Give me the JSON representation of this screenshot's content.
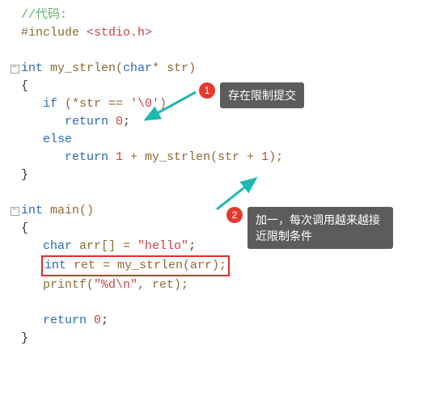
{
  "code": {
    "l1": "//代码:",
    "l2_pp": "#include ",
    "l2_hdr": "<stdio.h>",
    "l3": "",
    "l4_kw1": "int",
    "l4_fn": " my_strlen",
    "l4_p1": "(",
    "l4_kw2": "char",
    "l4_rest": "* str)",
    "l5": "{",
    "l6_if": "   if ",
    "l6_a": "(*str == ",
    "l6_ch": "'\\0'",
    "l6_b": ")",
    "l7_ret": "      return ",
    "l7_num": "0",
    "l7_sc": ";",
    "l8_else": "   else",
    "l9_ret": "      return ",
    "l9_num": "1",
    "l9_mid": " + my_strlen(str + ",
    "l9_num2": "1",
    "l9_end": ");",
    "l10": "}",
    "l12_kw": "int",
    "l12_fn": " main",
    "l12_p": "()",
    "l13": "{",
    "l14_a": "   ",
    "l14_kw": "char",
    "l14_mid": " arr[] = ",
    "l14_str": "\"hello\"",
    "l14_sc": ";",
    "l15_a": "   ",
    "l15_kw": "int",
    "l15_mid": " ret = my_strlen(arr);",
    "l16_a": "   printf(",
    "l16_str": "\"%d\\n\"",
    "l16_b": ", ret);",
    "l18_ret": "   return ",
    "l18_num": "0",
    "l18_sc": ";",
    "l19": "}"
  },
  "annotations": {
    "a1": {
      "num": "1",
      "text": "存在限制提交"
    },
    "a2": {
      "num": "2",
      "text": "加一，每次调用越来越接近限制条件"
    }
  },
  "fold": {
    "minus": "−"
  }
}
